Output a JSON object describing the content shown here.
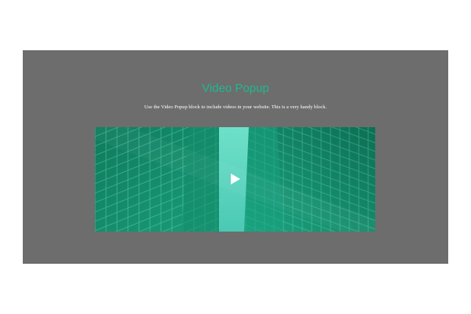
{
  "section": {
    "title": "Video Popup",
    "subtitle": "Use the Video Popup block to include videos in your website. This is a very handy block."
  },
  "video": {
    "thumbnail_icon": "buildings-image",
    "play_icon": "play-icon"
  },
  "colors": {
    "section_background": "#6d6d6d",
    "title": "#1fb890",
    "subtitle": "#ffffff",
    "video_tint": "#1a9e7a"
  }
}
